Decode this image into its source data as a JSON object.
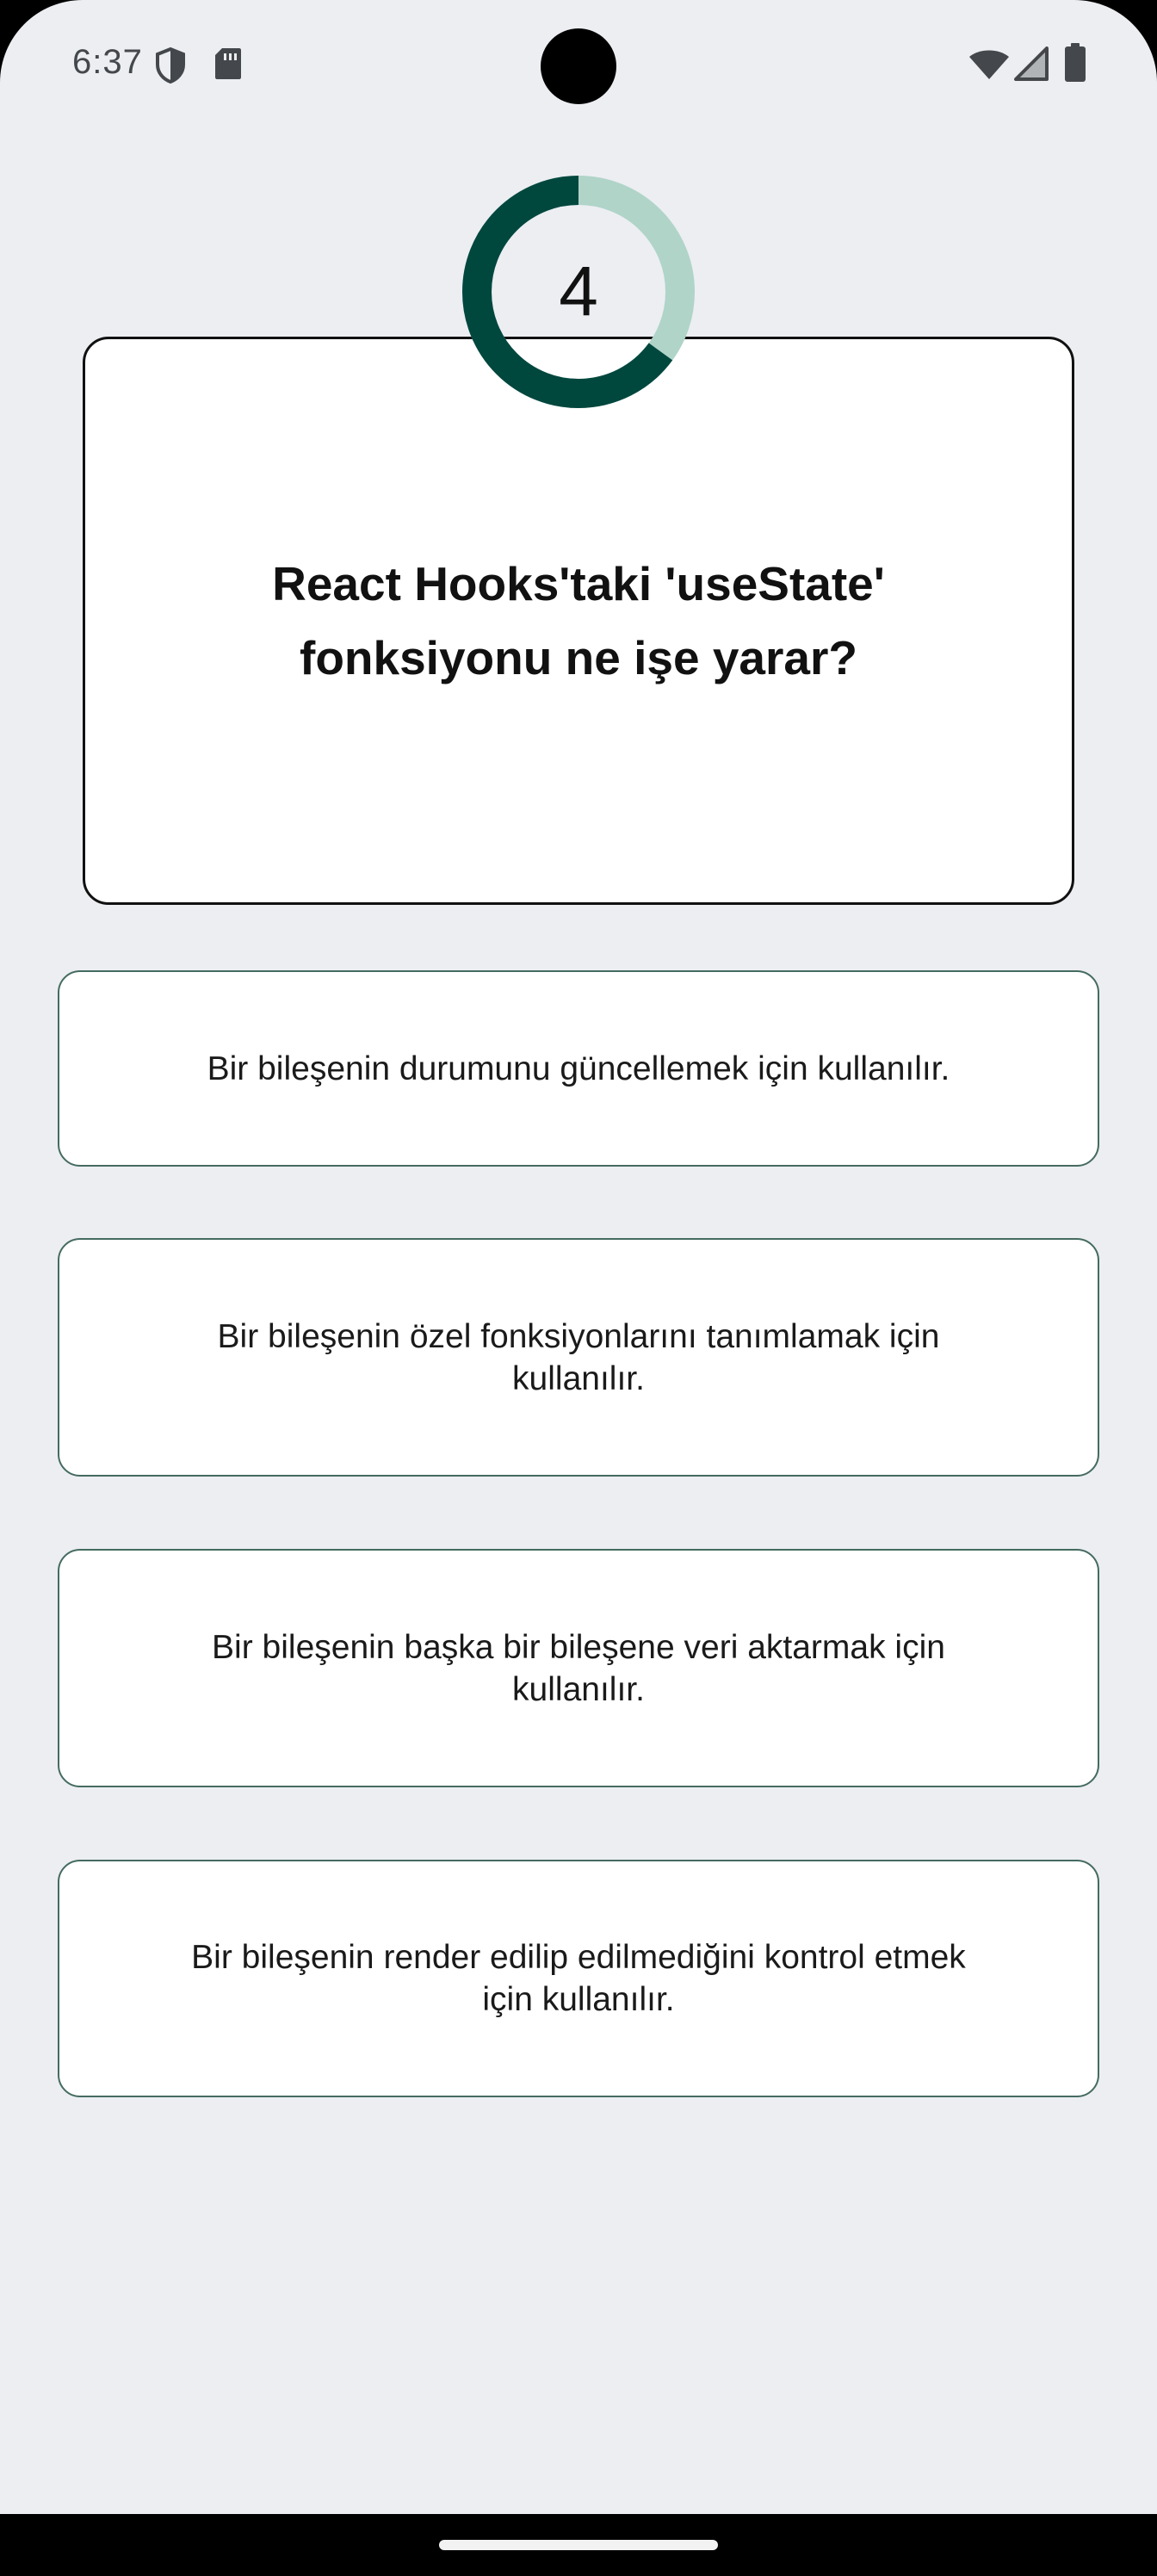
{
  "status_bar": {
    "time": "6:37",
    "icons_left": [
      "shield-icon",
      "sd-card-icon"
    ],
    "icons_right": [
      "wifi-icon",
      "cell-signal-icon",
      "battery-icon"
    ]
  },
  "timer": {
    "value": "4",
    "elapsed_fraction": 0.65,
    "track_color": "#b0d4c8",
    "progress_color": "#00473e"
  },
  "question": {
    "text": "React Hooks'taki 'useState' fonksiyonu ne işe yarar?"
  },
  "answers": [
    {
      "label": "Bir bileşenin durumunu güncellemek için kullanılır."
    },
    {
      "label": "Bir bileşenin özel fonksiyonlarını tanımlamak için kullanılır."
    },
    {
      "label": "Bir bileşenin başka bir bileşene veri aktarmak için kullanılır."
    },
    {
      "label": "Bir bileşenin render edilip edilmediğini kontrol etmek için kullanılır."
    }
  ],
  "colors": {
    "background": "#eceef2",
    "card_border": "#111111",
    "answer_border": "#456b60"
  }
}
